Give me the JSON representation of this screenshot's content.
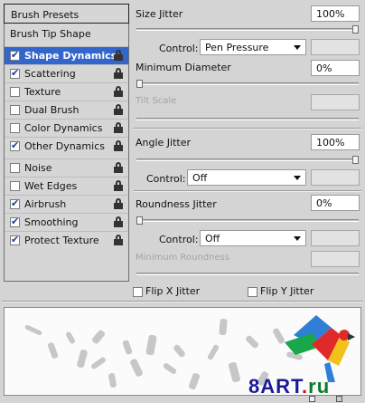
{
  "left_panel": {
    "presets_label": "Brush Presets",
    "tip_shape_label": "Brush Tip Shape",
    "items": [
      {
        "label": "Shape Dynamics",
        "checked": true,
        "selected": true
      },
      {
        "label": "Scattering",
        "checked": true,
        "selected": false
      },
      {
        "label": "Texture",
        "checked": false,
        "selected": false
      },
      {
        "label": "Dual Brush",
        "checked": false,
        "selected": false
      },
      {
        "label": "Color Dynamics",
        "checked": false,
        "selected": false
      },
      {
        "label": "Other Dynamics",
        "checked": true,
        "selected": false
      },
      {
        "label": "Noise",
        "checked": false,
        "selected": false
      },
      {
        "label": "Wet Edges",
        "checked": false,
        "selected": false
      },
      {
        "label": "Airbrush",
        "checked": true,
        "selected": false
      },
      {
        "label": "Smoothing",
        "checked": true,
        "selected": false
      },
      {
        "label": "Protect Texture",
        "checked": true,
        "selected": false
      }
    ]
  },
  "right_panel": {
    "size_jitter": {
      "label": "Size Jitter",
      "value": "100%",
      "level": 1.0
    },
    "size_control": {
      "label": "Control:",
      "value": "Pen Pressure"
    },
    "minimum_diameter": {
      "label": "Minimum Diameter",
      "value": "0%",
      "level": 0.0
    },
    "tilt_scale": {
      "label": "Tilt Scale"
    },
    "angle_jitter": {
      "label": "Angle Jitter",
      "value": "100%",
      "level": 1.0
    },
    "angle_control": {
      "label": "Control:",
      "value": "Off"
    },
    "roundness_jitter": {
      "label": "Roundness Jitter",
      "value": "0%",
      "level": 0.0
    },
    "roundness_control": {
      "label": "Control:",
      "value": "Off"
    },
    "minimum_roundness": {
      "label": "Minimum Roundness"
    },
    "flip_x": {
      "label": "Flip X Jitter",
      "checked": false
    },
    "flip_y": {
      "label": "Flip Y Jitter",
      "checked": false
    }
  },
  "watermark": {
    "brand": "8ART",
    "dot": ".",
    "tld": "ru"
  },
  "icons": {
    "lock": "lock-icon",
    "dropdown": "chevron-down-icon",
    "check": "checkmark-icon",
    "parrot": "parrot-logo"
  }
}
